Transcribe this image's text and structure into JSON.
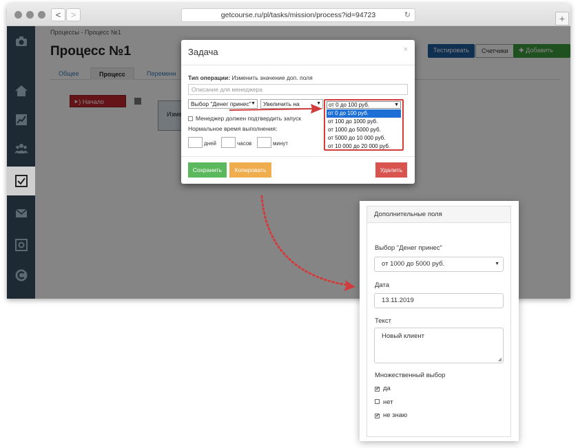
{
  "browser": {
    "url": "getcourse.ru/pl/tasks/mission/process?id=94723",
    "back": "<",
    "forward": ">",
    "reload": "↻",
    "new_tab": "+"
  },
  "page": {
    "breadcrumb": "Процессы - Процесс №1",
    "title": "Процесс №1",
    "tabs": [
      "Общее",
      "Процесс",
      "Переменн"
    ],
    "buttons": {
      "test": "Тестировать",
      "counters": "Счетчики",
      "add_block": "✚ Добавить блок ▾"
    },
    "node_start": "⯈) Начало работы",
    "node_change": "Изменит"
  },
  "modal": {
    "title": "Задача",
    "close": "×",
    "op_label": "Тип операции:",
    "op_value": " Изменить значение доп. поля",
    "description_placeholder": "Описание для менеджера",
    "select_field": "Выбор \"Денег принес\"",
    "select_action": "Увеличить на",
    "manager_confirm": "Менеджер должен подтвердить запуск",
    "normal_time": "Нормальное время выполнения:",
    "days": "дней",
    "hours": "часов",
    "minutes": "минут",
    "save": "Сохранить",
    "copy": "Копировать",
    "delete": "Удалить",
    "dropdown": {
      "selected": "от 0 до 100 руб.",
      "options": [
        "от 0 до 100 руб.",
        "от 100 до 1000 руб.",
        "от 1000 до 5000 руб.",
        "от 5000 до 10 000 руб.",
        "от 10 000 до 20 000 руб."
      ]
    }
  },
  "card": {
    "header": "Дополнительные поля",
    "field1_label": "Выбор \"Денег принес\"",
    "field1_value": "от 1000 до 5000 руб.",
    "date_label": "Дата",
    "date_value": "13.11.2019",
    "text_label": "Текст",
    "text_value": "Новый клиент",
    "multi_label": "Множественный выбор",
    "options": [
      {
        "label": "да",
        "checked": true
      },
      {
        "label": "нет",
        "checked": false
      },
      {
        "label": "не знаю",
        "checked": true
      }
    ]
  },
  "colors": {
    "sidebar": "#1d2a33",
    "save": "#5cb85c",
    "copy": "#f0ad4e",
    "delete": "#d9534f",
    "test": "#1f5d9c",
    "add_block": "#3d9a3d",
    "arrow": "#d23c3c",
    "highlight": "#1d6fd6"
  }
}
